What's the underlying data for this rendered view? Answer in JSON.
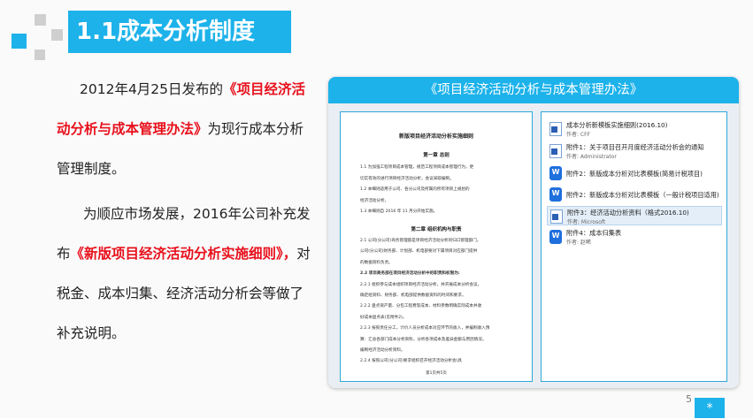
{
  "slide": {
    "title": "1.1成本分析制度",
    "paragraph1": {
      "pre": "2012年4月25日发布的",
      "highlight": "《项目经济活动分析与成本管理办法》",
      "post": "为现行成本分析管理制度。"
    },
    "paragraph2": {
      "pre": "为顺应市场发展，2016年公司补充发布",
      "highlight": "《新版项目经济活动分析实施细则》，",
      "post": "对税金、成本归集、经济活动分析会等做了补充说明。"
    },
    "page_number": "5",
    "corner_symbol": "*",
    "accent_color": "#1db2ea",
    "highlight_color": "#e8101c"
  },
  "card": {
    "header": "《项目经济活动分析与成本管理办法》",
    "document": {
      "title": "新版项目经济活动分析实施细则",
      "chapter1": "第一章  总则",
      "lines1": [
        "1.1   为加强工程项目成本管理，规范工程项目成本管理行为，更",
        "       切实有效的进行项目经济活动分析，会议采取编制。",
        "1.2   本细则适用于公司、各分公司及所属的所有项目上规划的",
        "       经济活动分析。",
        "1.3   本细则自 2016 年 11 月分开始实施。"
      ],
      "chapter2": "第二章  组织机构与职责",
      "lines2": [
        "2.1 公司(分公司)商务管理部是项目经济活动分析的归口管理部门，",
        "公司(分公司)财务部、计划部、机电部要对下属项目对应部门提供",
        "的数据资料负责。",
        "2.2 项目商务部在项目经济活动分析中的职责和权限为:",
        "2.2.1 组织参与成本组织项目经济活动分析，并开展成本分析会议，",
        "确定给资料、财务部、机电部提供数据资料的时间和要求。",
        "2.2.2 盘点资产量、分包工程费等成本、材料参数明确实际成本并收",
        "好成本盘点表(见附件2)。",
        "2.2.3 按照责任分工，计价人员分析成本对应环节的收入，并编制收入预",
        "算：汇总各部门成本分析资料，分析各项成本及差异金额与原因情况，",
        "编制经济活动分析资料。",
        "2.2.4 按照公司(分公司)要求组织召开经济活动分析会(具"
      ],
      "footer": "第1页共5页"
    },
    "files": [
      {
        "name": "成本分析新模板实施细则(2016.10)",
        "author": "作者: CFF",
        "icon": "word-doc-icon"
      },
      {
        "name": "附件1：关于项目召开月度经济活动分析会的通知",
        "author": "作者: Administrator",
        "icon": "word-doc-icon"
      },
      {
        "name": "附件2：新版成本分析对比表模板(简易计税项目)",
        "author": "",
        "icon": "wps-doc-icon"
      },
      {
        "name": "附件2：新版成本分析对比表模板（一般计税项目适用)",
        "author": "",
        "icon": "wps-doc-icon"
      },
      {
        "name": "附件3：经济活动分析资料（格式2016.10)",
        "author": "作者: Microsoft",
        "icon": "word-doc-icon"
      },
      {
        "name": "附件4：成本归集表",
        "author": "作者: 赵晞",
        "icon": "wps-doc-icon"
      }
    ]
  }
}
